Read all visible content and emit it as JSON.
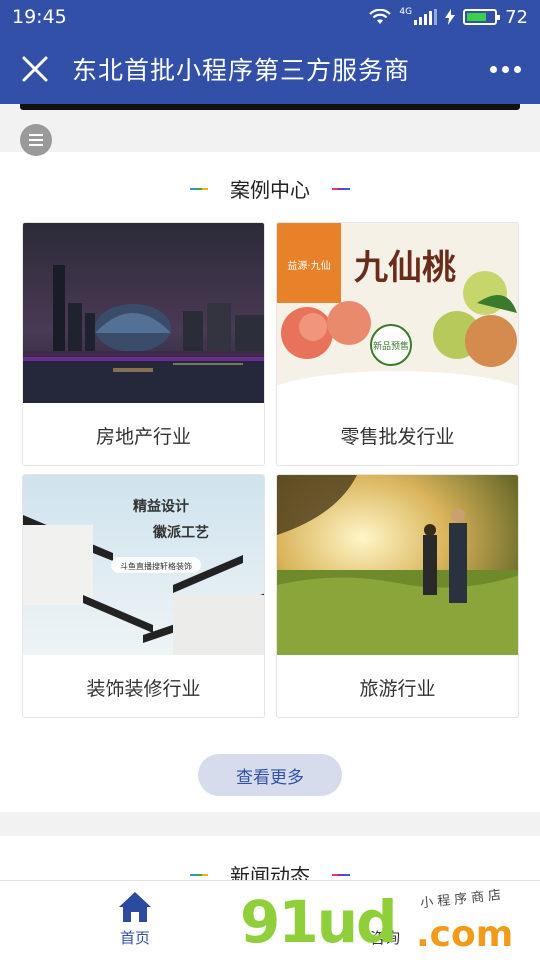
{
  "status_bar": {
    "time": "19:45",
    "network": "4G",
    "battery": "72",
    "battery_level": 0.72
  },
  "nav": {
    "title": "东北首批小程序第三方服务商"
  },
  "cases": {
    "title": "案例中心",
    "items": [
      {
        "label": "房地产行业",
        "image": "city-night-skyline"
      },
      {
        "label": "零售批发行业",
        "image": "peach-promo",
        "poster_big": "九仙桃",
        "poster_badge": "新品预售",
        "poster_brand": "益源·九仙"
      },
      {
        "label": "装饰装修行业",
        "image": "hui-style-architecture",
        "poster_line1": "精益设计",
        "poster_line2": "徽派工艺",
        "poster_sub": "斗鱼直播搜轩格装饰"
      },
      {
        "label": "旅游行业",
        "image": "hikers-in-field"
      }
    ],
    "more_label": "查看更多"
  },
  "news": {
    "title": "新闻动态"
  },
  "tab_bar": {
    "items": [
      {
        "label": "首页",
        "icon": "home-icon",
        "active": true
      },
      {
        "label": "咨询",
        "icon": "chat-icon",
        "active": false
      }
    ]
  },
  "watermark": {
    "main": "91ud",
    "suffix": ".com",
    "tagline": "小程序商店"
  },
  "colors": {
    "brand": "#3350a8",
    "more_btn_bg": "#d7dcec",
    "watermark_green": "#8fcf3a",
    "watermark_orange": "#f29a1a"
  }
}
